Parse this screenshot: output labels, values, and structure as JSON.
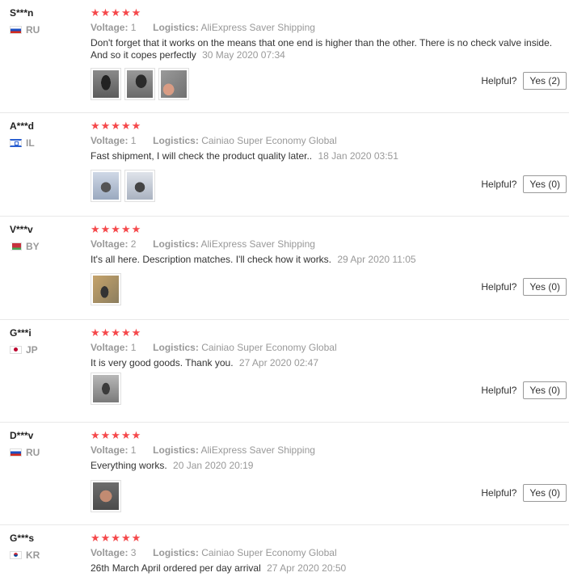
{
  "labels": {
    "voltage": "Voltage:",
    "logistics": "Logistics:",
    "helpful": "Helpful?",
    "stars": "★★★★★"
  },
  "reviews": [
    {
      "user": "S***n",
      "country": "RU",
      "voltage": "1",
      "logistics": "AliExpress Saver Shipping",
      "text": "Don't forget that it works on the means that one end is higher than the other. There is no check valve inside. And so it copes perfectly",
      "date": "30 May 2020 07:34",
      "helpful": "Yes (2)",
      "photos": [
        "photo-1",
        "photo-2",
        "photo-3"
      ]
    },
    {
      "user": "A***d",
      "country": "IL",
      "voltage": "1",
      "logistics": "Cainiao Super Economy Global",
      "text": "Fast shipment, I will check the product quality later..",
      "date": "18 Jan 2020 03:51",
      "helpful": "Yes (0)",
      "photos": [
        "photo-1",
        "photo-2"
      ]
    },
    {
      "user": "V***v",
      "country": "BY",
      "voltage": "2",
      "logistics": "AliExpress Saver Shipping",
      "text": "It's all here. Description matches. I'll check how it works.",
      "date": "29 Apr 2020 11:05",
      "helpful": "Yes (0)",
      "photos": [
        "photo-1"
      ]
    },
    {
      "user": "G***i",
      "country": "JP",
      "voltage": "1",
      "logistics": "Cainiao Super Economy Global",
      "text": "It is very good goods. Thank you.",
      "date": "27 Apr 2020 02:47",
      "helpful": "Yes (0)",
      "photos": [
        "photo-1"
      ]
    },
    {
      "user": "D***v",
      "country": "RU",
      "voltage": "1",
      "logistics": "AliExpress Saver Shipping",
      "text": "Everything works.",
      "date": "20 Jan 2020 20:19",
      "helpful": "Yes (0)",
      "photos": [
        "photo-1"
      ]
    },
    {
      "user": "G***s",
      "country": "KR",
      "voltage": "3",
      "logistics": "Cainiao Super Economy Global",
      "text": "26th March April ordered per day arrival",
      "date": "27 Apr 2020 20:50"
    }
  ],
  "colors": {
    "star": "#f5484b",
    "muted": "#999999"
  }
}
